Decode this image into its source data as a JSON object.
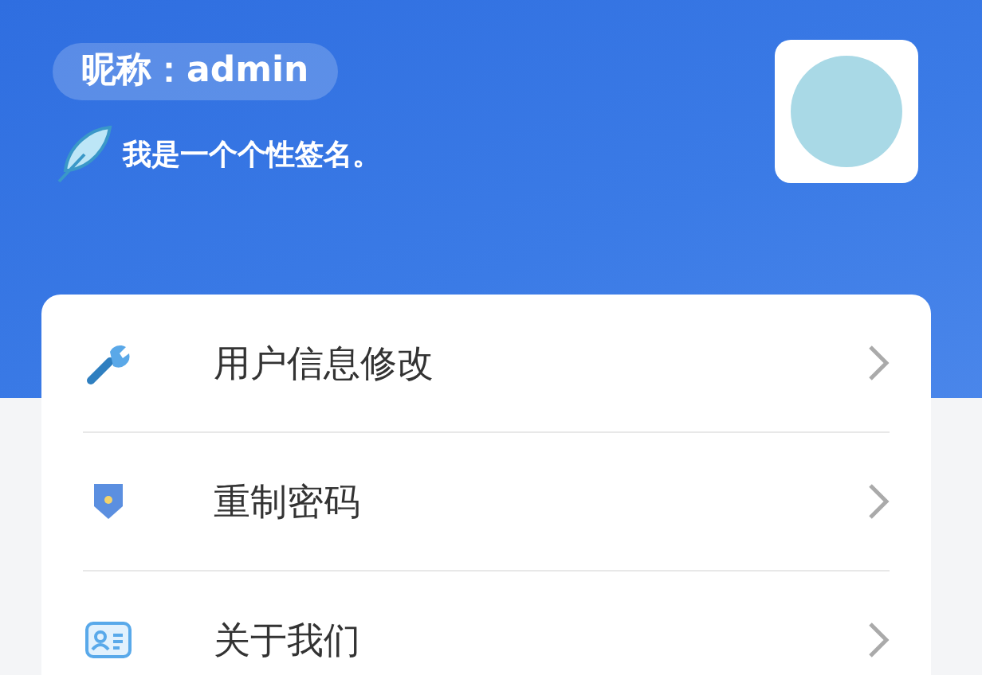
{
  "profile": {
    "nickname": "昵称：admin",
    "signature": "我是一个个性签名。"
  },
  "menu": [
    {
      "kind": "wrench",
      "label": "用户信息修改"
    },
    {
      "kind": "shield",
      "label": "重制密码"
    },
    {
      "kind": "card",
      "label": "关于我们"
    }
  ]
}
